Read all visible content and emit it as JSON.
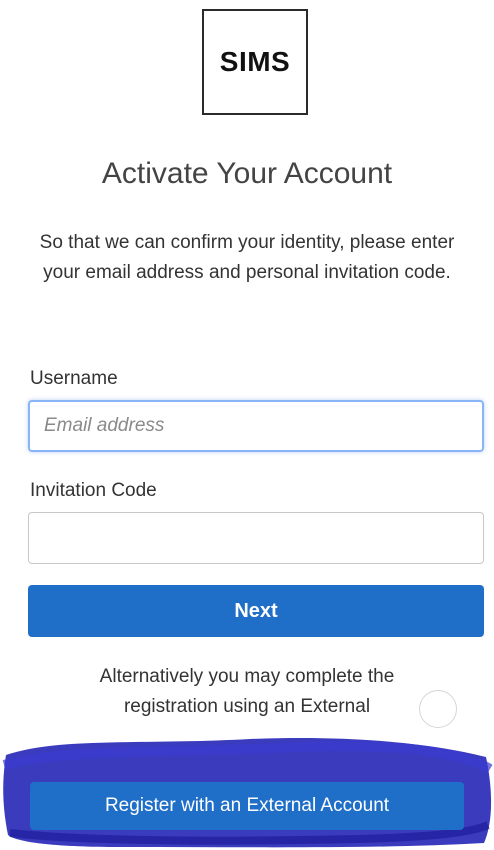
{
  "logo": {
    "text": "SIMS"
  },
  "page": {
    "title": "Activate Your Account",
    "intro": "So that we can confirm your identity, please enter your email address and personal invitation code."
  },
  "form": {
    "username_label": "Username",
    "username_placeholder": "Email address",
    "username_value": "",
    "invitation_label": "Invitation Code",
    "invitation_value": "",
    "next_label": "Next"
  },
  "alternative": {
    "text": "Alternatively you may complete the registration using an External",
    "external_button_label": "Register with an External Account"
  },
  "colors": {
    "primary_button": "#1f6fc8",
    "focus_border": "#8ab4f8",
    "scribble": "#2a2ab8"
  },
  "icons": {
    "loading": "loading-spinner-icon"
  }
}
